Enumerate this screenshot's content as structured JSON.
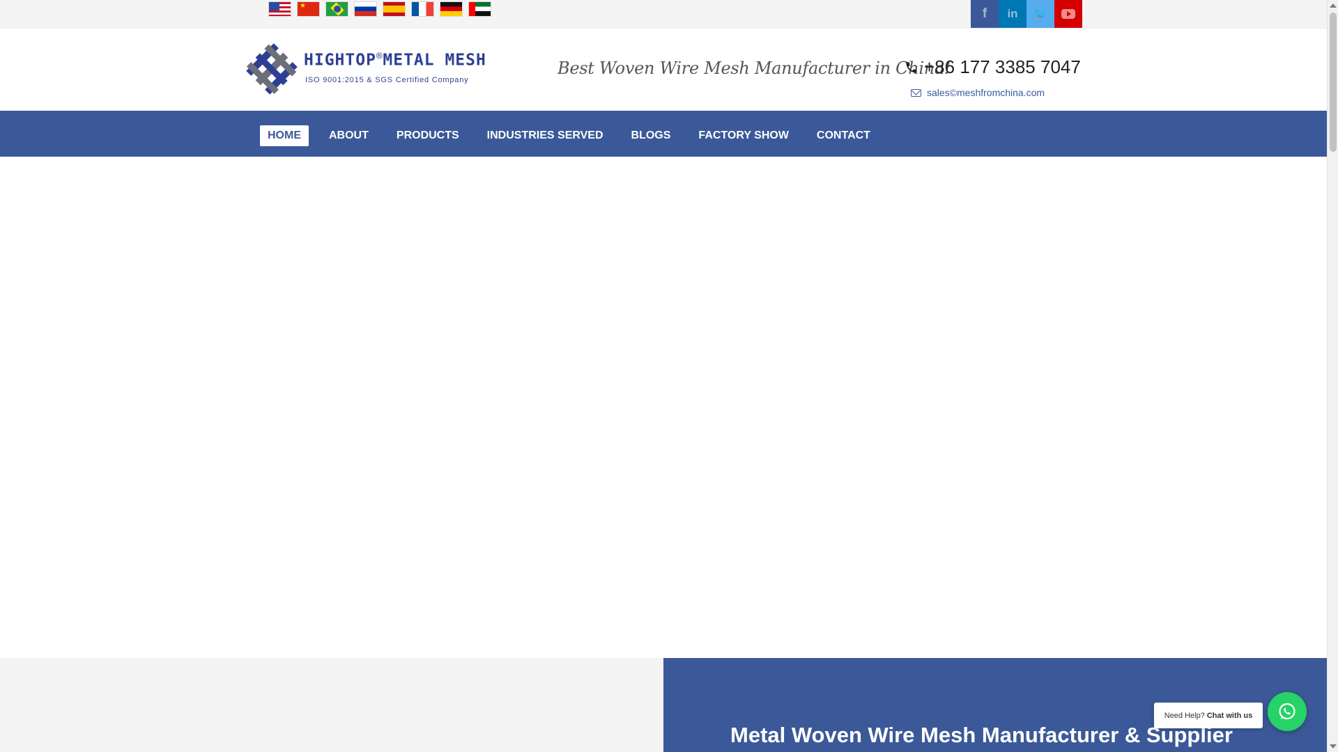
{
  "topbar": {
    "flags": [
      {
        "code": "us",
        "icon": "us-flag-icon"
      },
      {
        "code": "cn",
        "icon": "china-flag-icon"
      },
      {
        "code": "br",
        "icon": "brazil-flag-icon"
      },
      {
        "code": "ru",
        "icon": "russia-flag-icon"
      },
      {
        "code": "es",
        "icon": "spain-flag-icon"
      },
      {
        "code": "fr",
        "icon": "france-flag-icon"
      },
      {
        "code": "de",
        "icon": "germany-flag-icon"
      },
      {
        "code": "ae",
        "icon": "uae-flag-icon"
      }
    ],
    "social": {
      "facebook": {
        "glyph": "f",
        "color": "#3b5998"
      },
      "linkedin": {
        "glyph": "in",
        "color": "#0077b5"
      },
      "twitter": {
        "glyph": "🐦",
        "color": "#55acee"
      },
      "youtube": {
        "color": "#d40000"
      }
    }
  },
  "header": {
    "logo_name": "HIGHTOP",
    "logo_registered": "®",
    "logo_name_2": "METAL MESH",
    "logo_subtitle": "ISO 9001:2015 & SGS Certified Company",
    "tagline": "Best Woven Wire Mesh Manufacturer in China!",
    "phone": "+86 177 3385 7047",
    "email": "sales©meshfromchina.com"
  },
  "nav": {
    "items": [
      {
        "label": "HOME"
      },
      {
        "label": "ABOUT"
      },
      {
        "label": "PRODUCTS"
      },
      {
        "label": "INDUSTRIES SERVED"
      },
      {
        "label": "BLOGS"
      },
      {
        "label": "FACTORY SHOW"
      },
      {
        "label": "CONTACT"
      }
    ],
    "active_index": 0
  },
  "section": {
    "title": "Metal Woven Wire Mesh Manufacturer & Supplier"
  },
  "chat": {
    "prefix": "Need Help?",
    "cta": "Chat with us"
  },
  "colors": {
    "brand_blue": "#3b5998",
    "logo_blue": "#2d3f95",
    "whatsapp_green": "#25d366"
  }
}
